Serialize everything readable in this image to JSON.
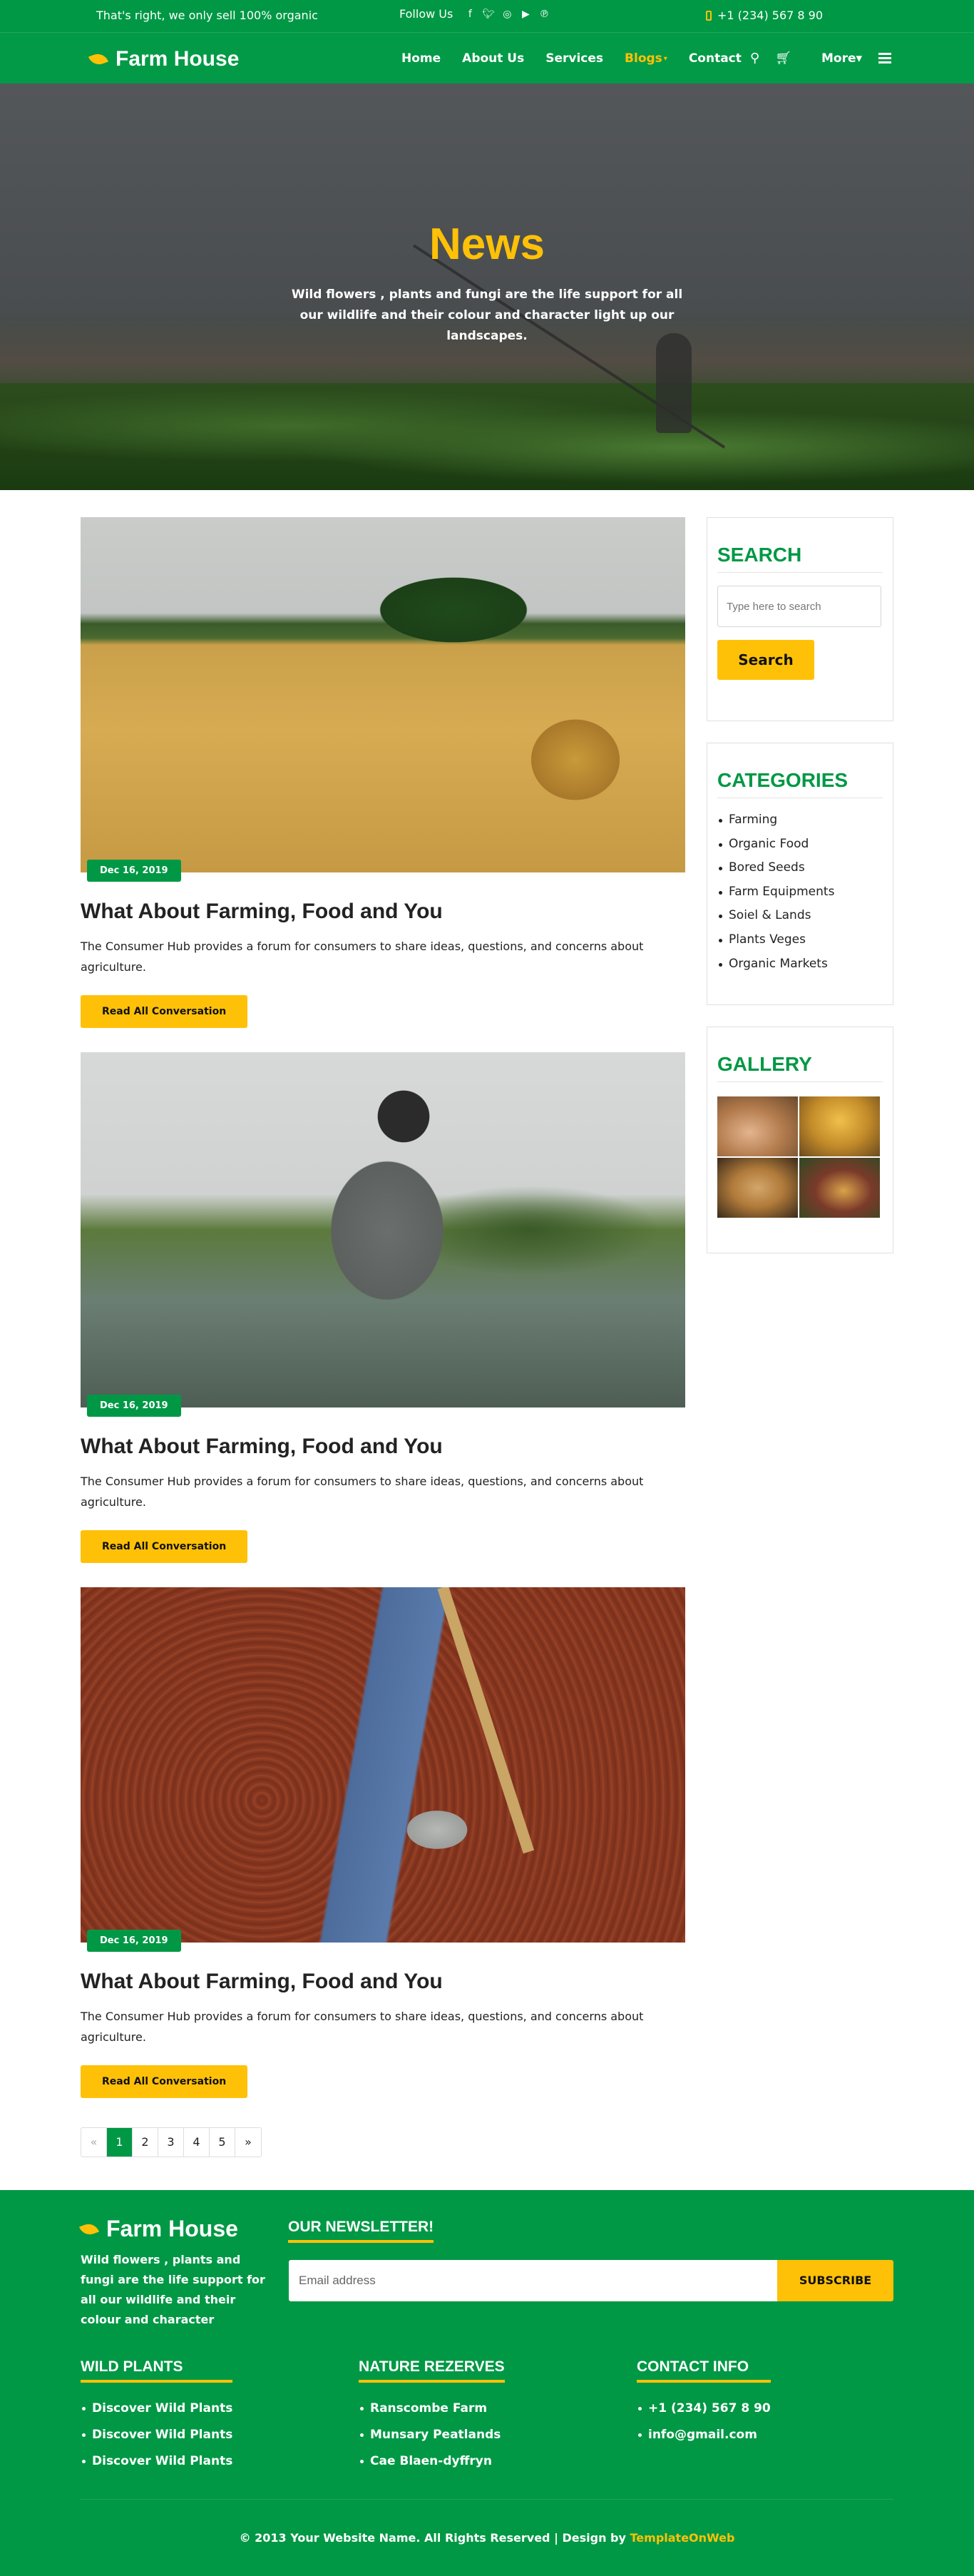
{
  "topbar": {
    "tagline": "That's right, we only sell 100% organic",
    "follow_label": "Follow Us",
    "social_icons": [
      "facebook-icon",
      "twitter-icon",
      "instagram-icon",
      "youtube-icon",
      "pinterest-icon"
    ],
    "phone": "+1 (234) 567 8 90"
  },
  "nav": {
    "brand": "Farm House",
    "items": [
      {
        "label": "Home"
      },
      {
        "label": "About Us"
      },
      {
        "label": "Services"
      },
      {
        "label": "Blogs",
        "active": true
      },
      {
        "label": "Contact"
      }
    ],
    "more_label": "More"
  },
  "hero": {
    "title": "News",
    "subtitle": "Wild flowers , plants and fungi are the life support for all our wildlife and their colour and character light up our landscapes."
  },
  "posts": [
    {
      "date": "Dec 16, 2019",
      "title": "What About Farming, Food and You",
      "excerpt": "The Consumer Hub provides a forum for consumers to share ideas, questions, and concerns about agriculture.",
      "button": "Read All Conversation"
    },
    {
      "date": "Dec 16, 2019",
      "title": "What About Farming, Food and You",
      "excerpt": "The Consumer Hub provides a forum for consumers to share ideas, questions, and concerns about agriculture.",
      "button": "Read All Conversation"
    },
    {
      "date": "Dec 16, 2019",
      "title": "What About Farming, Food and You",
      "excerpt": "The Consumer Hub provides a forum for consumers to share ideas, questions, and concerns about agriculture.",
      "button": "Read All Conversation"
    }
  ],
  "pagination": {
    "prev": "«",
    "pages": [
      "1",
      "2",
      "3",
      "4",
      "5"
    ],
    "current": "1",
    "next": "»"
  },
  "sidebar": {
    "search": {
      "title": "SEARCH",
      "placeholder": "Type here to search",
      "button": "Search"
    },
    "categories": {
      "title": "CATEGORIES",
      "items": [
        "Farming",
        "Organic Food",
        "Bored Seeds",
        "Farm Equipments",
        "Soiel & Lands",
        "Plants Veges",
        "Organic Markets"
      ]
    },
    "gallery": {
      "title": "GALLERY"
    }
  },
  "footer": {
    "brand": "Farm House",
    "about": "Wild flowers , plants and fungi are the life support for all our wildlife and their colour and character",
    "newsletter": {
      "title": "OUR NEWSLETTER!",
      "placeholder": "Email address",
      "button": "SUBSCRIBE"
    },
    "wild_plants": {
      "title": "WILD PLANTS",
      "items": [
        "Discover Wild Plants",
        "Discover Wild Plants",
        "Discover Wild Plants"
      ]
    },
    "nature": {
      "title": "NATURE REZERVES",
      "items": [
        "Ranscombe Farm",
        "Munsary Peatlands",
        "Cae Blaen-dyffryn"
      ]
    },
    "contact": {
      "title": "CONTACT INFO",
      "items": [
        "+1 (234) 567 8 90",
        "info@gmail.com"
      ]
    },
    "copyright_text": "© 2013 Your Website Name. All Rights Reserved | Design by",
    "copyright_link": "TemplateOnWeb"
  },
  "colors": {
    "brand_green": "#009845",
    "accent_yellow": "#ffc107"
  }
}
